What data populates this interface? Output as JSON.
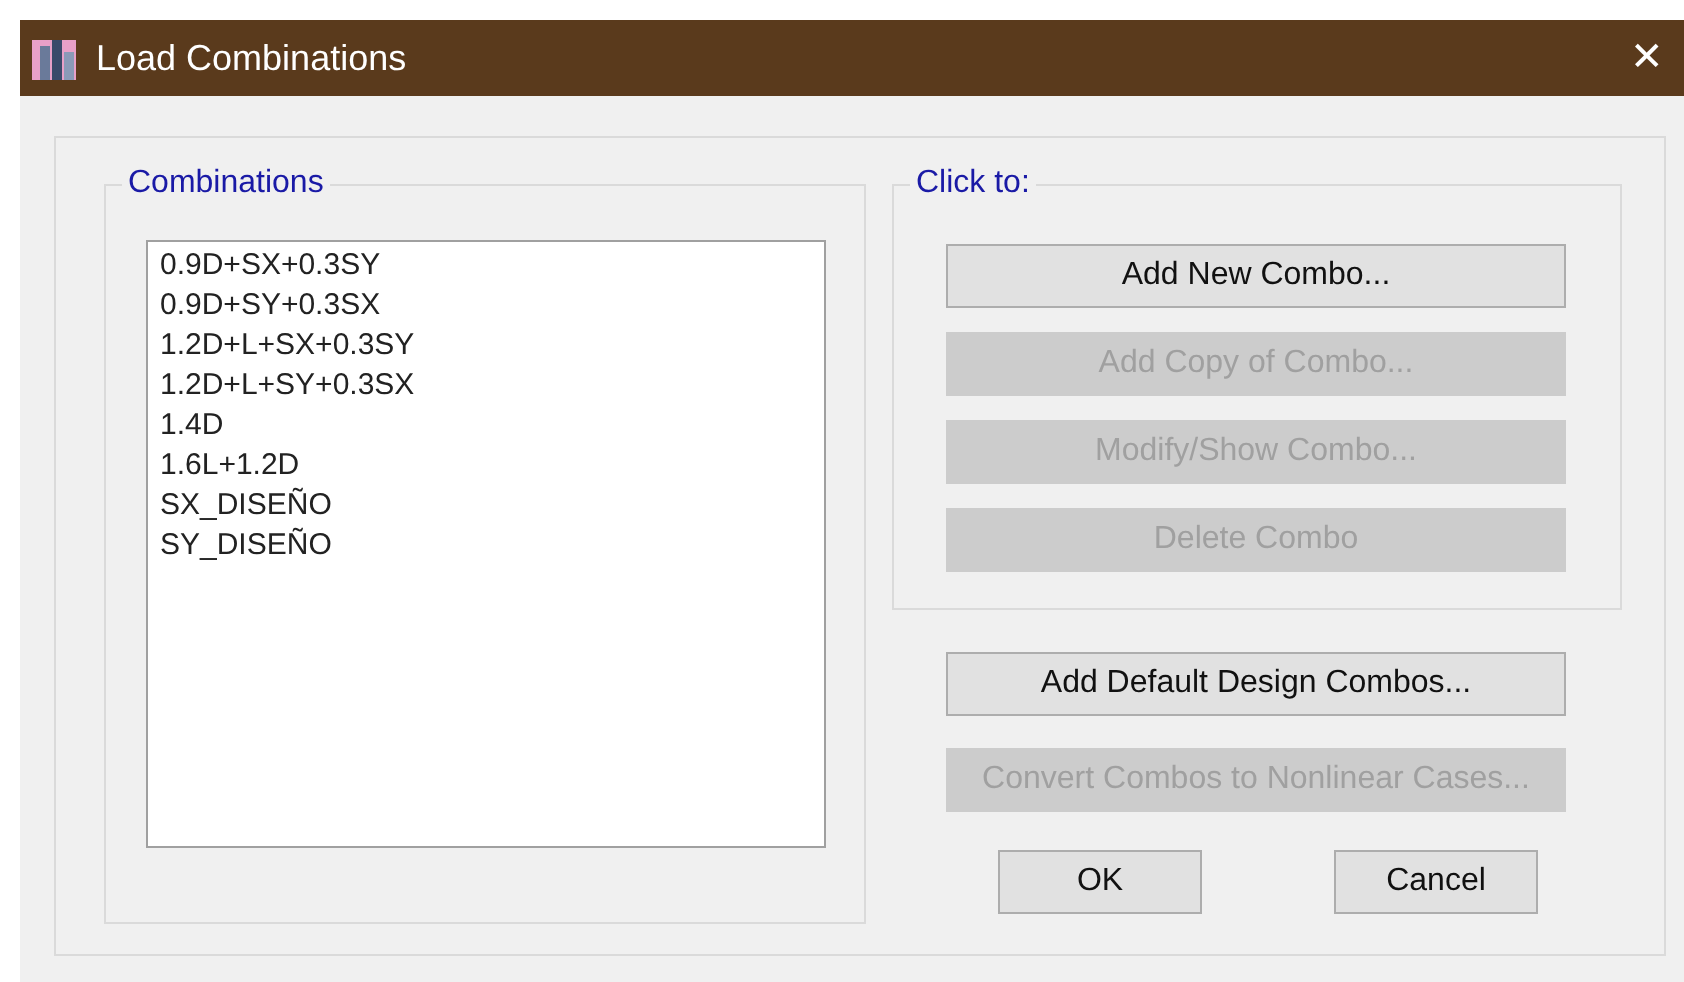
{
  "window": {
    "title": "Load Combinations",
    "close": "✕"
  },
  "combinations": {
    "label": "Combinations",
    "items": [
      "0.9D+SX+0.3SY",
      "0.9D+SY+0.3SX",
      "1.2D+L+SX+0.3SY",
      "1.2D+L+SY+0.3SX",
      "1.4D",
      "1.6L+1.2D",
      "SX_DISEÑO",
      "SY_DISEÑO"
    ]
  },
  "click_to": {
    "label": "Click to:",
    "buttons": [
      {
        "label": "Add New Combo...",
        "disabled": false
      },
      {
        "label": "Add Copy of Combo...",
        "disabled": true
      },
      {
        "label": "Modify/Show Combo...",
        "disabled": true
      },
      {
        "label": "Delete Combo",
        "disabled": true
      }
    ]
  },
  "extra_buttons": [
    {
      "label": "Add Default Design Combos...",
      "disabled": false
    },
    {
      "label": "Convert Combos to Nonlinear Cases...",
      "disabled": true
    }
  ],
  "buttons": [
    "OK",
    "Cancel"
  ]
}
